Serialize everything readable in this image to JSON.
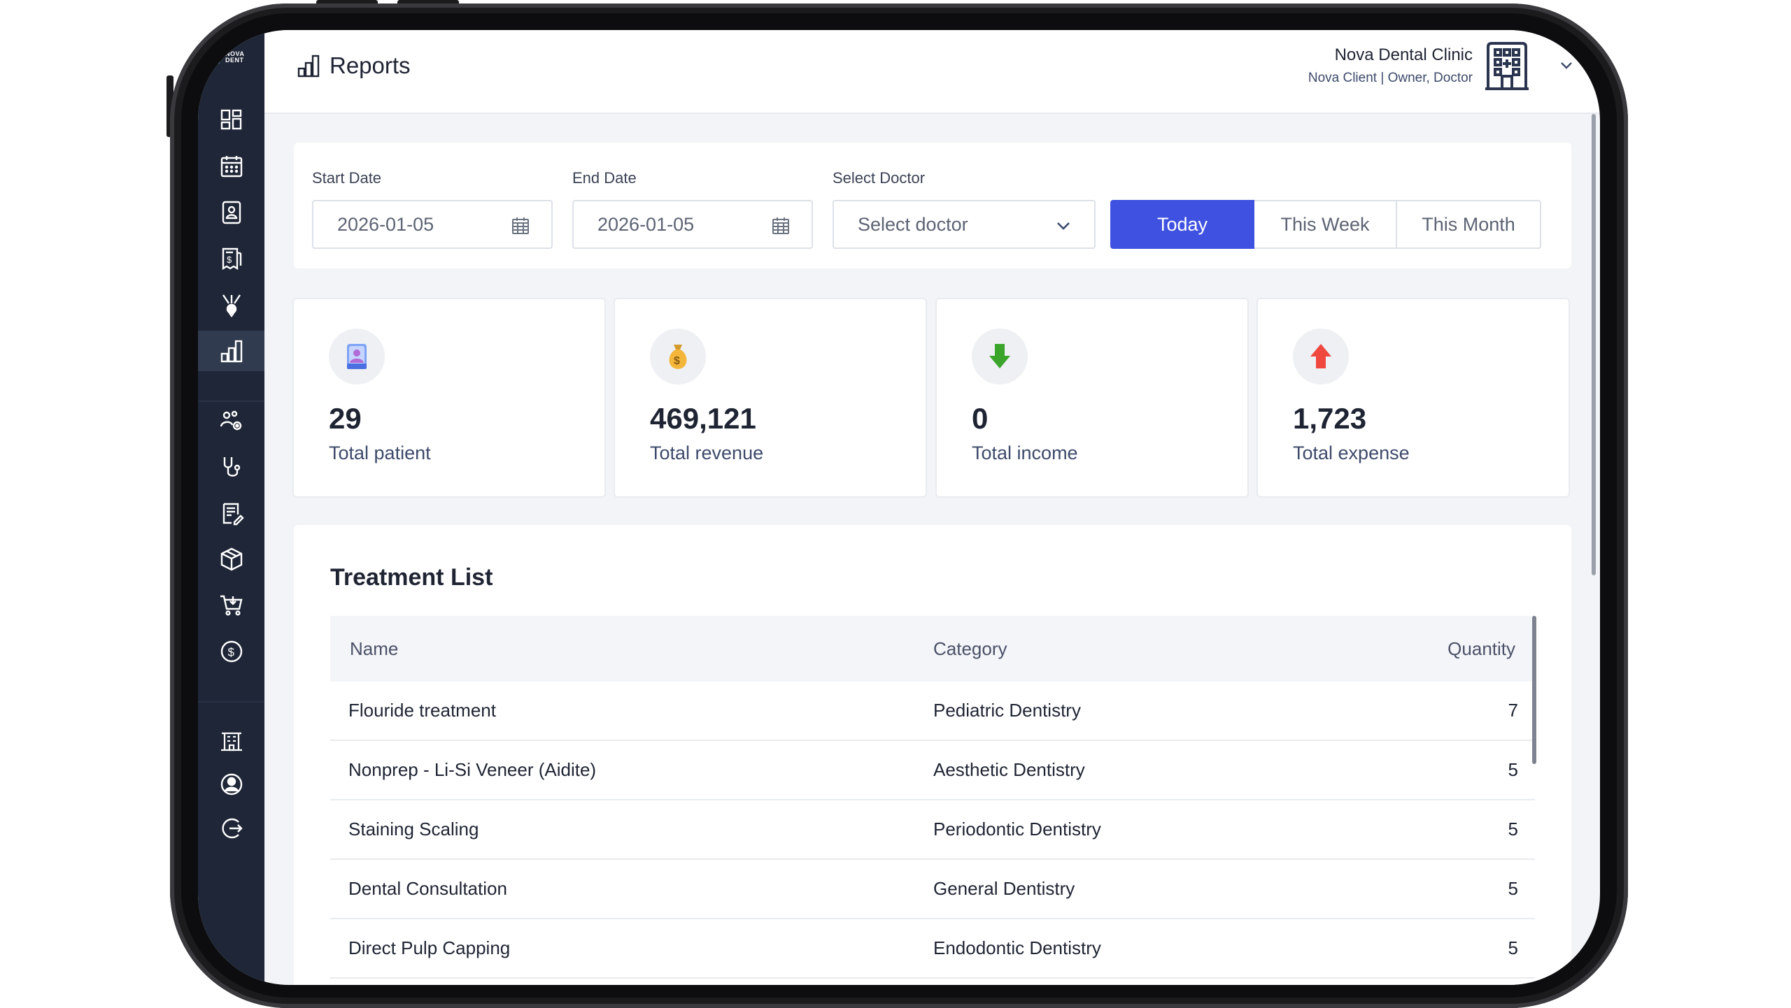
{
  "app": {
    "logo_line1": "NOVA",
    "logo_line2": "DENT"
  },
  "header": {
    "title": "Reports",
    "clinic_name": "Nova Dental Clinic",
    "user_role": "Nova Client | Owner, Doctor"
  },
  "sidebar": {
    "items": [
      {
        "icon": "dashboard-icon"
      },
      {
        "icon": "calendar-icon"
      },
      {
        "icon": "patient-card-icon"
      },
      {
        "icon": "invoice-icon"
      },
      {
        "icon": "dental-tools-icon"
      },
      {
        "icon": "reports-icon",
        "active": true
      },
      {
        "icon": "staff-settings-icon"
      },
      {
        "icon": "stethoscope-icon"
      },
      {
        "icon": "prescription-icon"
      },
      {
        "icon": "inventory-box-icon"
      },
      {
        "icon": "shopping-cart-icon"
      },
      {
        "icon": "dollar-icon"
      },
      {
        "icon": "clinic-building-icon"
      },
      {
        "icon": "profile-icon"
      },
      {
        "icon": "logout-icon"
      }
    ]
  },
  "filters": {
    "start_date_label": "Start Date",
    "start_date_value": "2026-01-05",
    "end_date_label": "End Date",
    "end_date_value": "2026-01-05",
    "doctor_label": "Select Doctor",
    "doctor_placeholder": "Select doctor",
    "periods": [
      "Today",
      "This Week",
      "This Month"
    ],
    "active_period": "Today"
  },
  "stats": [
    {
      "value": "29",
      "label": "Total patient",
      "icon": "patient-badge-icon"
    },
    {
      "value": "469,121",
      "label": "Total revenue",
      "icon": "money-bag-icon"
    },
    {
      "value": "0",
      "label": "Total income",
      "icon": "arrow-down-icon"
    },
    {
      "value": "1,723",
      "label": "Total expense",
      "icon": "arrow-up-icon"
    }
  ],
  "treatment": {
    "title": "Treatment List",
    "columns": [
      "Name",
      "Category",
      "Quantity"
    ],
    "rows": [
      [
        "Flouride treatment",
        "Pediatric Dentistry",
        "7"
      ],
      [
        "Nonprep - Li-Si Veneer (Aidite)",
        "Aesthetic Dentistry",
        "5"
      ],
      [
        "Staining Scaling",
        "Periodontic Dentistry",
        "5"
      ],
      [
        "Dental Consultation",
        "General Dentistry",
        "5"
      ],
      [
        "Direct Pulp Capping",
        "Endodontic Dentistry",
        "5"
      ]
    ]
  },
  "colors": {
    "sidebar_bg": "#1e2637",
    "accent": "#3f51e0",
    "income_green": "#3aa52a",
    "expense_red": "#f0473f"
  }
}
